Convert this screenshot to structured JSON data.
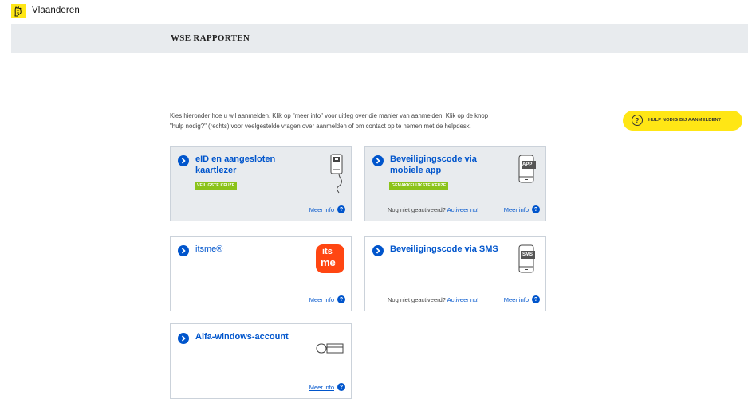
{
  "header": {
    "brand": "Vlaanderen",
    "title": "WSE RAPPORTEN"
  },
  "intro": {
    "line1": "Kies hieronder hoe u wil aanmelden. Klik op \"meer info\" voor uitleg over die manier van aanmelden. Klik op de knop",
    "line2": "\"hulp nodig?\" (rechts) voor veelgestelde vragen over aanmelden of om contact op te nemen met de helpdesk."
  },
  "help_button": {
    "label": "HULP NODIG BIJ AANMELDEN?",
    "icon": "question-icon"
  },
  "cards": {
    "eid": {
      "title": "eID en aangesloten kaartlezer",
      "badge": "VEILIGSTE KEUZE",
      "meer_info": "Meer info",
      "icon": "card-reader-icon"
    },
    "mobile": {
      "title": "Beveiligingscode via mobiele app",
      "badge": "GEMAKKELIJKSTE KEUZE",
      "not_activated": "Nog niet geactiveerd?",
      "activate": "Activeer nu!",
      "meer_info": "Meer info",
      "icon": "phone-app-icon",
      "icon_label": "APP"
    },
    "itsme": {
      "title": "itsme®",
      "meer_info": "Meer info",
      "logo_top": "its",
      "logo_bottom": "me",
      "icon": "itsme-logo"
    },
    "sms": {
      "title": "Beveiligingscode via SMS",
      "not_activated": "Nog niet geactiveerd?",
      "activate": "Activeer nu!",
      "meer_info": "Meer info",
      "icon": "phone-sms-icon",
      "icon_label": "SMS"
    },
    "alfa": {
      "title": "Alfa-windows-account",
      "meer_info": "Meer info",
      "icon": "account-card-icon"
    }
  },
  "colors": {
    "accent_blue": "#0055cc",
    "brand_yellow": "#ffe615",
    "badge_green": "#8bc31a",
    "itsme_red": "#ff4612",
    "panel_gray": "#e8ebee"
  }
}
